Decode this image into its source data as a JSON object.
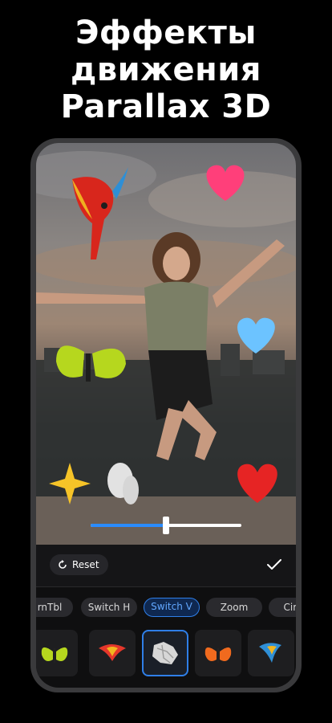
{
  "headline": {
    "line1": "Эффекты",
    "line2": "движения",
    "line3": "Parallax 3D"
  },
  "editor": {
    "slider_value": 0.5,
    "reset_label": "Reset",
    "confirm_icon": "checkmark-icon"
  },
  "effects": {
    "chips": [
      {
        "label": "rnTbl",
        "active": false
      },
      {
        "label": "Switch H",
        "active": false
      },
      {
        "label": "Switch V",
        "active": true
      },
      {
        "label": "Zoom",
        "active": false
      },
      {
        "label": "Circ",
        "active": false
      }
    ]
  },
  "stickers": {
    "thumbs": [
      {
        "icon": "butterfly-icon",
        "active": false
      },
      {
        "icon": "parrot-icon",
        "active": false
      },
      {
        "icon": "crumpled-paper-icon",
        "active": true
      },
      {
        "icon": "butterfly-icon",
        "active": false
      },
      {
        "icon": "parrot-icon",
        "active": false
      }
    ]
  },
  "colors": {
    "accent": "#2f7fe8",
    "background": "#000000"
  }
}
